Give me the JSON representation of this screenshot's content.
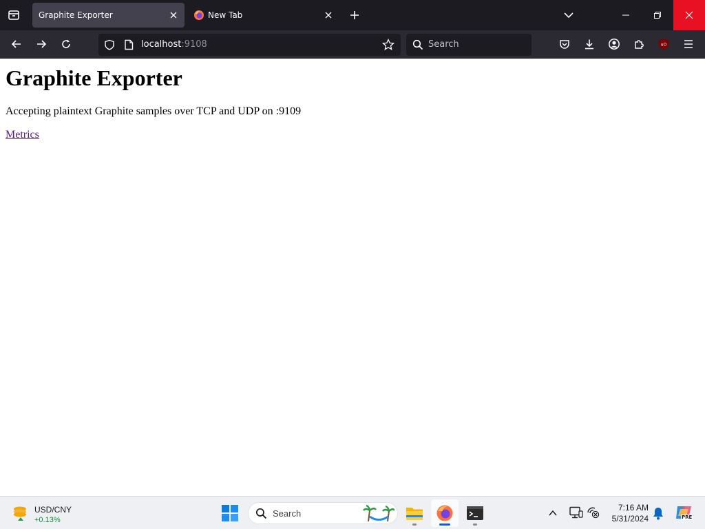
{
  "browser": {
    "tabs": [
      {
        "title": "Graphite Exporter",
        "active": true
      },
      {
        "title": "New Tab",
        "active": false
      }
    ],
    "url": {
      "host": "localhost",
      "port": ":9108"
    },
    "search_placeholder": "Search"
  },
  "page": {
    "heading": "Graphite Exporter",
    "description": "Accepting plaintext Graphite samples over TCP and UDP on :9109",
    "link_label": "Metrics"
  },
  "taskbar": {
    "widget": {
      "name": "USD/CNY",
      "change": "+0.13%"
    },
    "search_label": "Search",
    "clock": {
      "time": "7:16 AM",
      "date": "5/31/2024"
    },
    "copilot_badge": "PRE"
  },
  "colors": {
    "tab_strip": "#1c1b22",
    "toolbar": "#2b2a33",
    "close_hover": "#e81123",
    "link_visited": "#551a8b",
    "taskbar": "#eef0f4"
  }
}
